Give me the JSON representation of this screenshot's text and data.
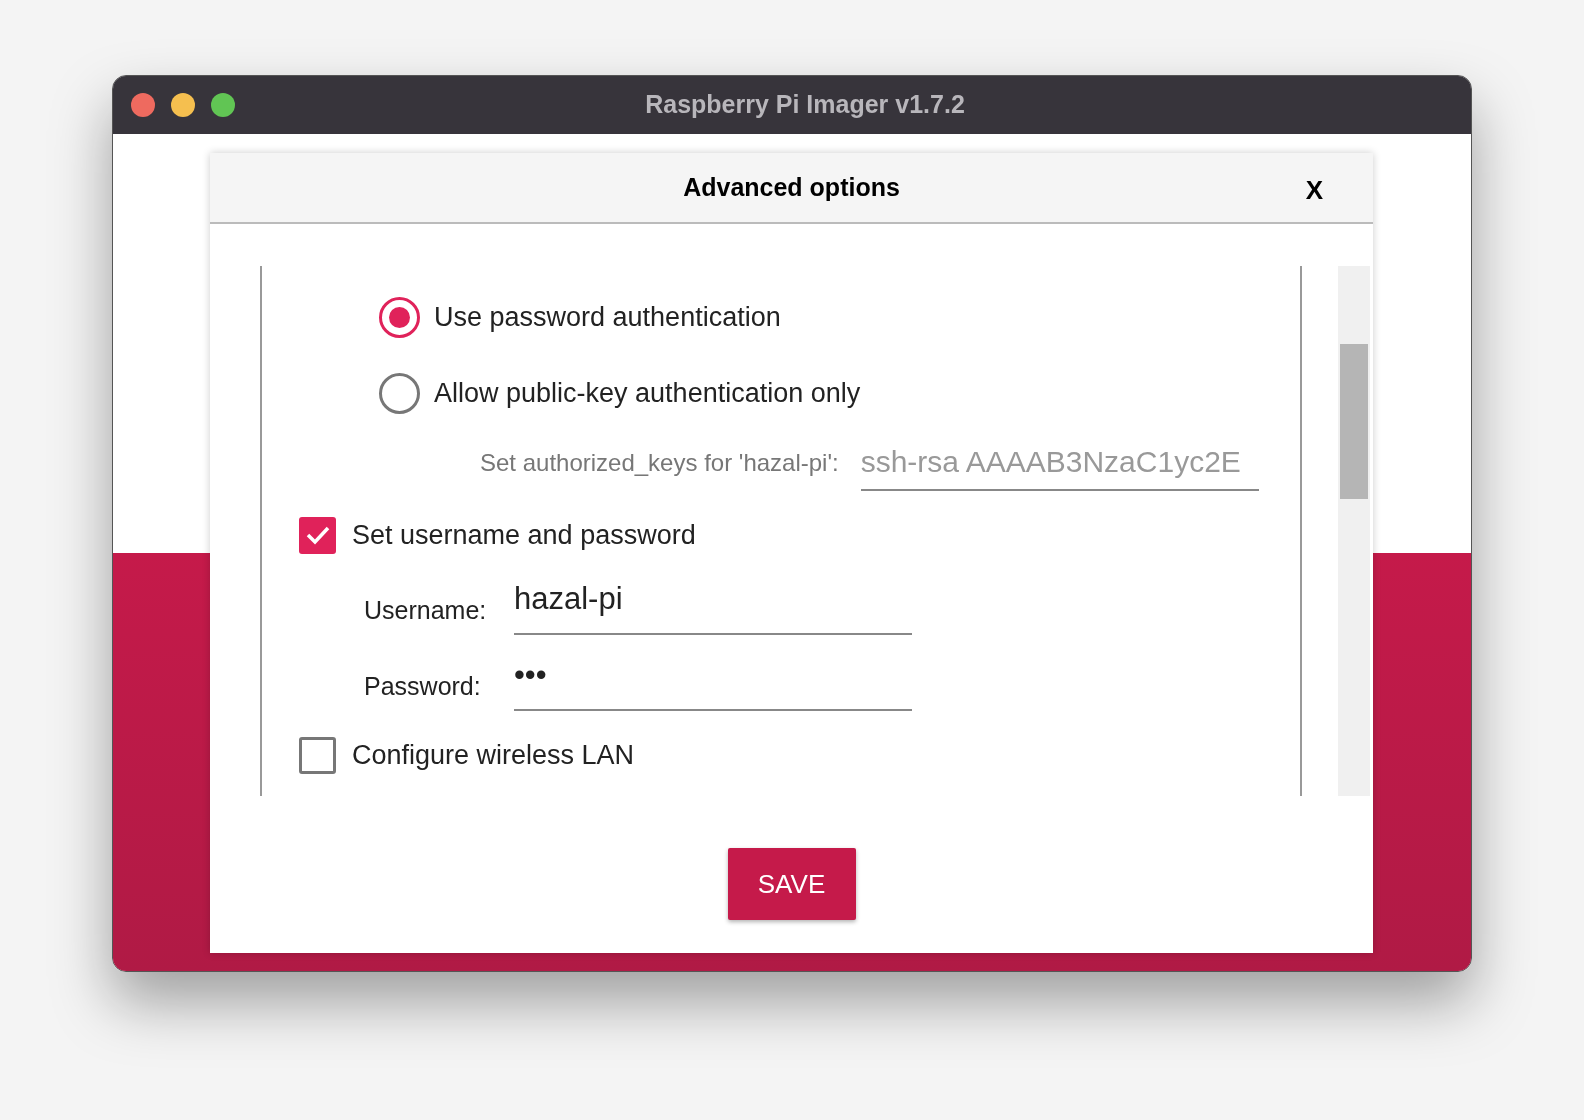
{
  "window": {
    "title": "Raspberry Pi Imager v1.7.2"
  },
  "dialog": {
    "title": "Advanced options",
    "close": "X"
  },
  "auth_options": [
    {
      "label": "Use password authentication",
      "selected": true
    },
    {
      "label": "Allow public-key authentication only",
      "selected": false
    }
  ],
  "authorized_keys": {
    "label": "Set authorized_keys for 'hazal-pi':",
    "value": "ssh-rsa AAAAB3NzaC1yc2E",
    "disabled": true
  },
  "user_section": {
    "label": "Set username and password",
    "checked": true,
    "fields": [
      {
        "label": "Username:",
        "value": "hazal-pi"
      },
      {
        "label": "Password:",
        "value": "•••"
      }
    ]
  },
  "wireless": {
    "label": "Configure wireless LAN",
    "checked": false
  },
  "save_button": "SAVE"
}
